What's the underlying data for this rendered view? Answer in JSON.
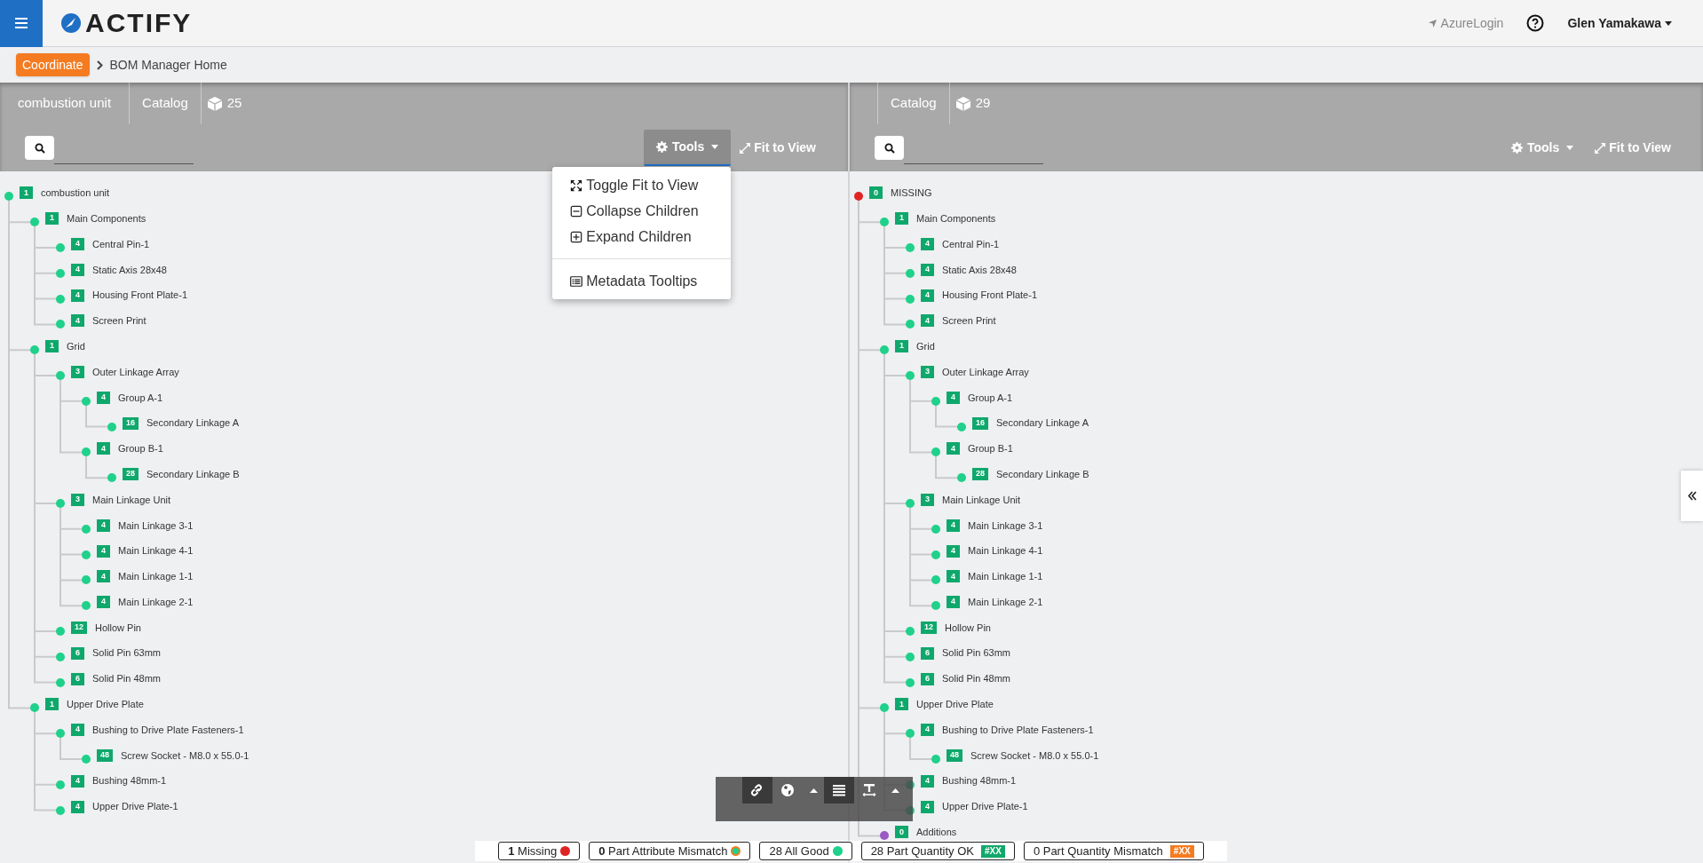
{
  "header": {
    "logo": "ACTIFY",
    "login": "AzureLogin",
    "user": "Glen Yamakawa"
  },
  "breadcrumb": {
    "badge": "Coordinate",
    "page": "BOM Manager Home"
  },
  "panels": [
    {
      "title": "combustion unit",
      "catalog": "Catalog",
      "count": "25",
      "tools": "Tools",
      "tools_open": true,
      "fit": "Fit to View",
      "tree": [
        {
          "count": "1",
          "label": "combustion unit",
          "children": [
            {
              "count": "1",
              "label": "Main Components",
              "children": [
                {
                  "count": "4",
                  "label": "Central Pin-1"
                },
                {
                  "count": "4",
                  "label": "Static Axis 28x48"
                },
                {
                  "count": "4",
                  "label": "Housing Front Plate-1"
                },
                {
                  "count": "4",
                  "label": "Screen Print"
                }
              ]
            },
            {
              "count": "1",
              "label": "Grid",
              "children": [
                {
                  "count": "3",
                  "label": "Outer Linkage Array",
                  "children": [
                    {
                      "count": "4",
                      "label": "Group A-1",
                      "children": [
                        {
                          "count": "16",
                          "label": "Secondary Linkage A"
                        }
                      ]
                    },
                    {
                      "count": "4",
                      "label": "Group B-1",
                      "children": [
                        {
                          "count": "28",
                          "label": "Secondary Linkage B"
                        }
                      ]
                    }
                  ]
                },
                {
                  "count": "3",
                  "label": "Main Linkage Unit",
                  "children": [
                    {
                      "count": "4",
                      "label": "Main Linkage 3-1"
                    },
                    {
                      "count": "4",
                      "label": "Main Linkage 4-1"
                    },
                    {
                      "count": "4",
                      "label": "Main Linkage 1-1"
                    },
                    {
                      "count": "4",
                      "label": "Main Linkage 2-1"
                    }
                  ]
                },
                {
                  "count": "12",
                  "label": "Hollow Pin"
                },
                {
                  "count": "6",
                  "label": "Solid Pin 63mm"
                },
                {
                  "count": "6",
                  "label": "Solid Pin 48mm"
                }
              ]
            },
            {
              "count": "1",
              "label": "Upper Drive Plate",
              "children": [
                {
                  "count": "4",
                  "label": "Bushing to Drive Plate Fasteners-1",
                  "children": [
                    {
                      "count": "48",
                      "label": "Screw Socket - M8.0 x 55.0-1"
                    }
                  ]
                },
                {
                  "count": "4",
                  "label": "Bushing 48mm-1"
                },
                {
                  "count": "4",
                  "label": "Upper Drive Plate-1"
                }
              ]
            }
          ]
        }
      ]
    },
    {
      "catalog": "Catalog",
      "count": "29",
      "tools": "Tools",
      "tools_open": false,
      "fit": "Fit to View",
      "tree": [
        {
          "count": "0",
          "label": "MISSING",
          "color": "#e02424",
          "children": [
            {
              "count": "1",
              "label": "Main Components",
              "children": [
                {
                  "count": "4",
                  "label": "Central Pin-1"
                },
                {
                  "count": "4",
                  "label": "Static Axis 28x48"
                },
                {
                  "count": "4",
                  "label": "Housing Front Plate-1"
                },
                {
                  "count": "4",
                  "label": "Screen Print"
                }
              ]
            },
            {
              "count": "1",
              "label": "Grid",
              "children": [
                {
                  "count": "3",
                  "label": "Outer Linkage Array",
                  "children": [
                    {
                      "count": "4",
                      "label": "Group A-1",
                      "children": [
                        {
                          "count": "16",
                          "label": "Secondary Linkage A"
                        }
                      ]
                    },
                    {
                      "count": "4",
                      "label": "Group B-1",
                      "children": [
                        {
                          "count": "28",
                          "label": "Secondary Linkage B"
                        }
                      ]
                    }
                  ]
                },
                {
                  "count": "3",
                  "label": "Main Linkage Unit",
                  "children": [
                    {
                      "count": "4",
                      "label": "Main Linkage 3-1"
                    },
                    {
                      "count": "4",
                      "label": "Main Linkage 4-1"
                    },
                    {
                      "count": "4",
                      "label": "Main Linkage 1-1"
                    },
                    {
                      "count": "4",
                      "label": "Main Linkage 2-1"
                    }
                  ]
                },
                {
                  "count": "12",
                  "label": "Hollow Pin"
                },
                {
                  "count": "6",
                  "label": "Solid Pin 63mm"
                },
                {
                  "count": "6",
                  "label": "Solid Pin 48mm"
                }
              ]
            },
            {
              "count": "1",
              "label": "Upper Drive Plate",
              "children": [
                {
                  "count": "4",
                  "label": "Bushing to Drive Plate Fasteners-1",
                  "children": [
                    {
                      "count": "48",
                      "label": "Screw Socket - M8.0 x 55.0-1"
                    }
                  ]
                },
                {
                  "count": "4",
                  "label": "Bushing 48mm-1"
                },
                {
                  "count": "4",
                  "label": "Upper Drive Plate-1"
                }
              ]
            },
            {
              "count": "0",
              "label": "Additions",
              "color": "#9b59c6"
            }
          ]
        }
      ]
    }
  ],
  "tools_menu": [
    {
      "kind": "toggle",
      "label": "Toggle Fit to View"
    },
    {
      "kind": "collapse",
      "label": "Collapse Children"
    },
    {
      "kind": "expand",
      "label": "Expand Children"
    },
    {
      "kind": "metadata",
      "label": "Metadata Tooltips"
    }
  ],
  "toolbar": [
    {
      "kind": "link",
      "selected": true
    },
    {
      "kind": "globe",
      "selected": false
    },
    {
      "kind": "caret",
      "selected": false
    },
    {
      "kind": "list",
      "selected": true
    },
    {
      "kind": "text",
      "selected": false
    },
    {
      "kind": "caret",
      "selected": false
    }
  ],
  "legend": [
    {
      "kind": "dot",
      "text": "**1** Missing",
      "color": "#e02424"
    },
    {
      "kind": "ring",
      "text": "**0** Part Attribute Mismatch",
      "color": "#1fd18a"
    },
    {
      "kind": "dot",
      "text": "28 All Good",
      "color": "#1fd18a"
    },
    {
      "kind": "tag",
      "text": "28 Part Quantity OK",
      "tag": "#XX",
      "color": "#10a86b"
    },
    {
      "kind": "tag",
      "text": "0 Part Quantity Mismatch",
      "tag": "#XX",
      "color": "#f47b20"
    }
  ]
}
